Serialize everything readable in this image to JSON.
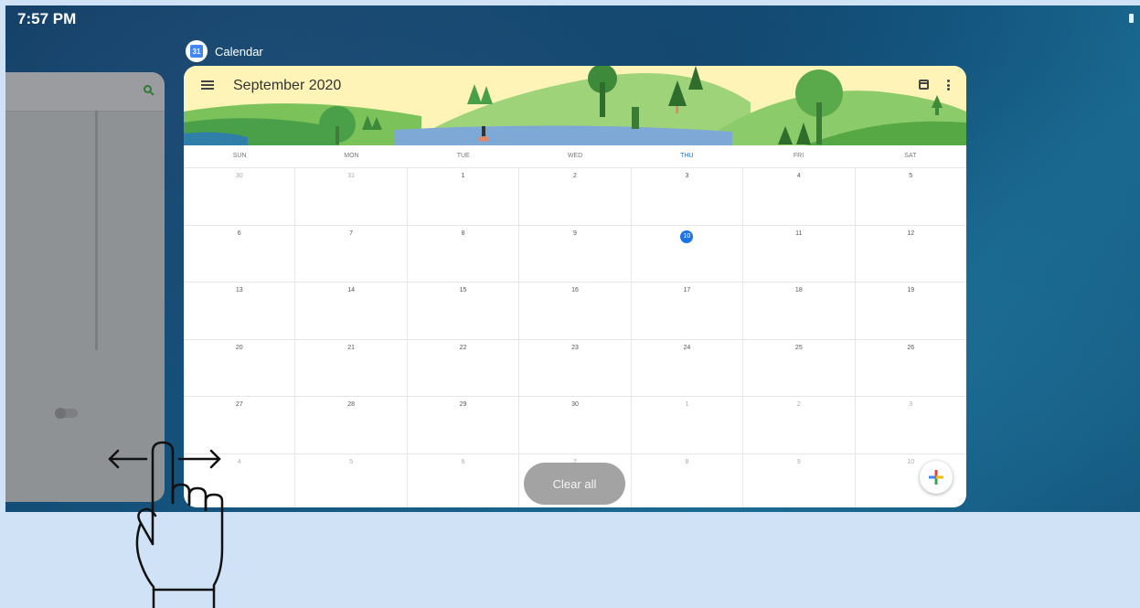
{
  "status_bar": {
    "time": "7:57 PM",
    "battery_icon": "battery-icon"
  },
  "prev_app": {
    "search_icon": "search-icon"
  },
  "app_label": {
    "name": "Calendar",
    "icon_text": "31"
  },
  "calendar": {
    "month_title": "September 2020",
    "days_of_week": [
      "SUN",
      "MON",
      "TUE",
      "WED",
      "THU",
      "FRI",
      "SAT"
    ],
    "today_column": 4,
    "weeks": [
      [
        {
          "d": "30",
          "other": true
        },
        {
          "d": "31",
          "other": true
        },
        {
          "d": "1"
        },
        {
          "d": "2"
        },
        {
          "d": "3"
        },
        {
          "d": "4"
        },
        {
          "d": "5"
        }
      ],
      [
        {
          "d": "6"
        },
        {
          "d": "7"
        },
        {
          "d": "8"
        },
        {
          "d": "9"
        },
        {
          "d": "10",
          "today": true
        },
        {
          "d": "11"
        },
        {
          "d": "12"
        }
      ],
      [
        {
          "d": "13"
        },
        {
          "d": "14"
        },
        {
          "d": "15"
        },
        {
          "d": "16"
        },
        {
          "d": "17"
        },
        {
          "d": "18"
        },
        {
          "d": "19"
        }
      ],
      [
        {
          "d": "20"
        },
        {
          "d": "21"
        },
        {
          "d": "22"
        },
        {
          "d": "23"
        },
        {
          "d": "24"
        },
        {
          "d": "25"
        },
        {
          "d": "26"
        }
      ],
      [
        {
          "d": "27"
        },
        {
          "d": "28"
        },
        {
          "d": "29"
        },
        {
          "d": "30"
        },
        {
          "d": "1",
          "other": true
        },
        {
          "d": "2",
          "other": true
        },
        {
          "d": "3",
          "other": true
        }
      ],
      [
        {
          "d": "4",
          "other": true
        },
        {
          "d": "5",
          "other": true
        },
        {
          "d": "6",
          "other": true
        },
        {
          "d": "7",
          "other": true
        },
        {
          "d": "8",
          "other": true
        },
        {
          "d": "9",
          "other": true
        },
        {
          "d": "10",
          "other": true
        }
      ]
    ]
  },
  "overview": {
    "clear_all_label": "Clear all"
  },
  "colors": {
    "accent": "#1a73e8",
    "backdrop": "#cfe2f6"
  }
}
